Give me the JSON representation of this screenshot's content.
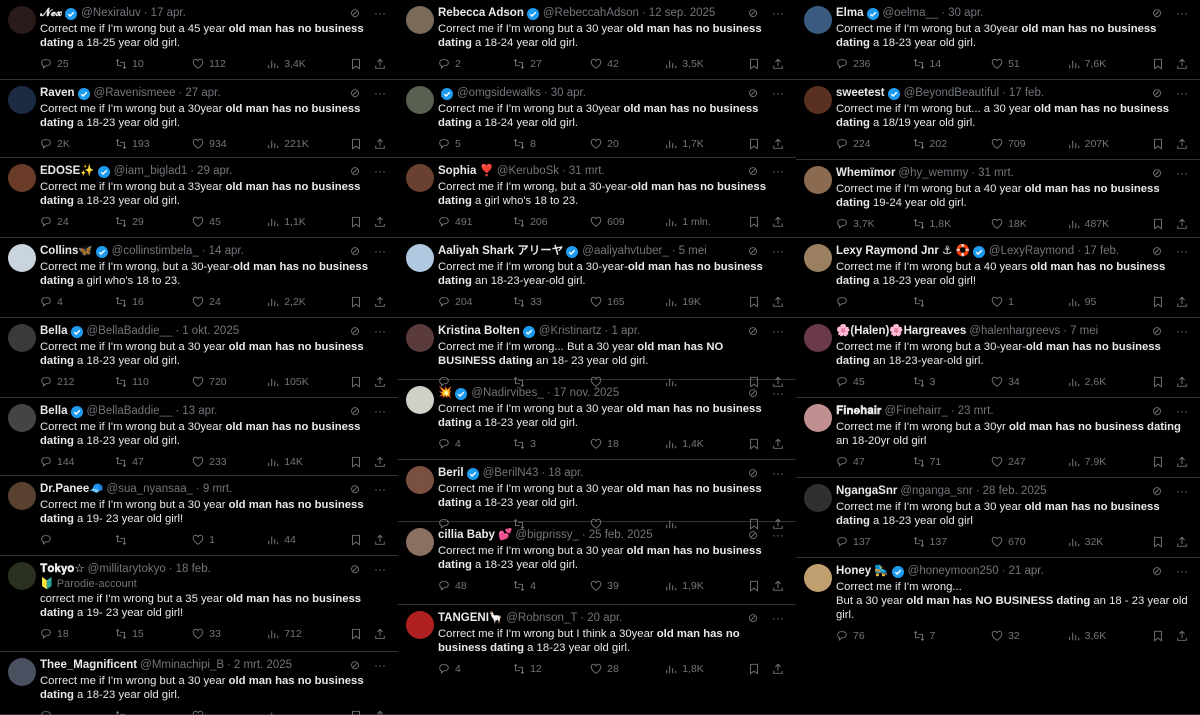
{
  "columns": [
    [
      {
        "name": "𝓝𝓮𝔁",
        "handle": "@Nexiraluv",
        "date": "17 apr.",
        "verified": true,
        "pre": "Correct me if I'm wrong but a 45 year ",
        "bold": "old man has no business dating",
        "post": " a 18-25 year old girl.",
        "replies": "25",
        "reposts": "10",
        "likes": "112",
        "views": "3,4K",
        "avatar": "#2b1a1a"
      },
      {
        "name": "Raven",
        "handle": "@Ravenismeee",
        "date": "27 apr.",
        "verified": true,
        "pre": "Correct me if I'm wrong but a 30year ",
        "bold": "old man has no business dating",
        "post": " a 18-23 year old girl.",
        "replies": "2K",
        "reposts": "193",
        "likes": "934",
        "views": "221K",
        "avatar": "#1d2a44"
      },
      {
        "name": "EDOSE✨",
        "handle": "@iam_biglad1",
        "date": "29 apr.",
        "verified": true,
        "pre": "Correct me if I'm wrong but a 33year ",
        "bold": "old man has no business dating",
        "post": " a 18-23 year old girl.",
        "replies": "24",
        "reposts": "29",
        "likes": "45",
        "views": "1,1K",
        "avatar": "#6b3b2a"
      },
      {
        "name": "Collins🦋",
        "handle": "@collinstimbela_",
        "date": "14 apr.",
        "verified": true,
        "pre": "Correct me if I'm wrong, but a 30-year-",
        "bold": "old man has no business dating",
        "post": " a girl who's 18 to 23.",
        "replies": "4",
        "reposts": "16",
        "likes": "24",
        "views": "2,2K",
        "avatar": "#c9d4de"
      },
      {
        "name": "Bella",
        "handle": "@BellaBaddie__",
        "date": "1 okt. 2025",
        "verified": true,
        "pre": "Correct me if I'm wrong but a 30 year ",
        "bold": "old man has no business dating",
        "post": " a 18-23 year old girl.",
        "replies": "212",
        "reposts": "110",
        "likes": "720",
        "views": "105K",
        "avatar": "#3a3a3a"
      },
      {
        "name": "Bella",
        "handle": "@BellaBaddie__",
        "date": "13 apr.",
        "verified": true,
        "pre": "Correct me if I'm wrong but a 30year ",
        "bold": "old man has no business dating",
        "post": " a 18-23 year old girl.",
        "replies": "144",
        "reposts": "47",
        "likes": "233",
        "views": "14K",
        "avatar": "#444"
      },
      {
        "name": "Dr.Panee🧢",
        "handle": "@sua_nyansaa_",
        "date": "9 mrt.",
        "verified": false,
        "pre": "Correct me if I'm wrong but a 30 year ",
        "bold": "old man has no business dating",
        "post": " a 19- 23 year old girl!",
        "replies": "",
        "reposts": "",
        "likes": "1",
        "views": "44",
        "avatar": "#5a4030"
      },
      {
        "name": "𝐓𝐨𝐤𝐲𝐨☆",
        "handle": "@millitarytokyo",
        "date": "18 feb.",
        "verified": false,
        "sub": "🔰 Parodie-account",
        "pre": "correct me if I'm wrong but a 35 year ",
        "bold": "old man has no business  dating",
        "post": " a 19- 23 year old girl!",
        "replies": "18",
        "reposts": "15",
        "likes": "33",
        "views": "712",
        "avatar": "#2a3020"
      },
      {
        "name": "Thee_Magnificent",
        "handle": "@Mminachipi_B",
        "date": "2 mrt. 2025",
        "verified": false,
        "pre": "Correct me if I'm wrong but a 30 year ",
        "bold": "old man has no business dating",
        "post": " a 18-23 year old girl.",
        "replies": "",
        "reposts": "",
        "likes": "",
        "views": "",
        "avatar": "#4a5060"
      }
    ],
    [
      {
        "name": "Rebecca Adson",
        "handle": "@RebeccahAdson",
        "date": "12 sep. 2025",
        "verified": true,
        "pre": "Correct me if I'm wrong but a 30 year ",
        "bold": "old man has no business dating",
        "post": " a 18-24 year old girl.",
        "replies": "2",
        "reposts": "27",
        "likes": "42",
        "views": "3,5K",
        "avatar": "#7a6a5a"
      },
      {
        "name": "",
        "handle": "@omgsidewalks",
        "date": "30 apr.",
        "verified": true,
        "pre": "Correct me if I'm wrong but a 30year ",
        "bold": "old man has no business dating",
        "post": " a 18-24 year old girl.",
        "replies": "5",
        "reposts": "8",
        "likes": "20",
        "views": "1,7K",
        "avatar": "#5a6050"
      },
      {
        "name": "Sophia ❣️",
        "handle": "@KeruboSk",
        "date": "31 mrt.",
        "verified": false,
        "pre": "Correct me if I'm wrong, but a 30-year-",
        "bold": "old man has no business dating",
        "post": " a girl who's 18 to 23.",
        "replies": "491",
        "reposts": "206",
        "likes": "609",
        "views": "1 mln.",
        "avatar": "#6a4030"
      },
      {
        "name": "Aaliyah Shark アリーヤ",
        "handle": "@aaliyahvtuber_",
        "date": "5 mei",
        "verified": true,
        "pre": "Correct me if I'm wrong but a 30-year-",
        "bold": "old man has no business dating",
        "post": " an 18-23-year-old girl.",
        "replies": "204",
        "reposts": "33",
        "likes": "165",
        "views": "19K",
        "avatar": "#b0c8e0"
      },
      {
        "name": "Kristina Bolten",
        "handle": "@Kristinartz",
        "date": "1 apr.",
        "verified": true,
        "pre": "Correct me if I'm wrong... But a 30 year ",
        "bold": "old man has NO BUSINESS dating",
        "post": " an 18- 23 year old girl.",
        "replies": "",
        "reposts": "",
        "likes": "",
        "views": "",
        "avatar": "#5a3a3a"
      },
      {
        "name": "💥",
        "handle": "@Nadirvibes_",
        "date": "17 nov. 2025",
        "verified": true,
        "pre": "Correct me if I'm wrong but a 30 year ",
        "bold": "old man has no business dating",
        "post": " a 18-23 year old girl.",
        "replies": "4",
        "reposts": "3",
        "likes": "18",
        "views": "1,4K",
        "avatar": "#d0d0c8"
      },
      {
        "name": "Beril",
        "handle": "@BerilN43",
        "date": "18 apr.",
        "verified": true,
        "pre": "Correct me if I'm wrong but a 30 year ",
        "bold": "old man has no business  dating",
        "post": " a 18-23 year old girl.",
        "replies": "",
        "reposts": "",
        "likes": "",
        "views": "",
        "avatar": "#7a5040"
      },
      {
        "name": "cillia Baby 💕",
        "handle": "@bigprissy_",
        "date": "25 feb. 2025",
        "verified": false,
        "pre": "Correct me if I'm wrong but a 30 year ",
        "bold": "old man has no business dating",
        "post": " a 18-23 year old girl.",
        "replies": "48",
        "reposts": "4",
        "likes": "39",
        "views": "1,9K",
        "avatar": "#8a7060"
      },
      {
        "name": "TANGENI🦙",
        "handle": "@Robnson_T",
        "date": "20 apr.",
        "verified": false,
        "pre": "Correct me if I'm wrong but I think a 30year ",
        "bold": "old man has no business dating",
        "post": " a 18-23 year old girl.",
        "replies": "4",
        "reposts": "12",
        "likes": "28",
        "views": "1,8K",
        "avatar": "#b02020"
      }
    ],
    [
      {
        "name": "Elma",
        "handle": "@oelma__",
        "date": "30 apr.",
        "verified": true,
        "pre": "Correct me if I'm wrong but a 30year ",
        "bold": "old man has no business dating",
        "post": " a 18-23 year old girl.",
        "replies": "236",
        "reposts": "14",
        "likes": "51",
        "views": "7,6K",
        "avatar": "#3a5a80"
      },
      {
        "name": "sweetest",
        "handle": "@BeyondBeautiful",
        "date": "17 feb.",
        "verified": true,
        "pre": "Correct me if I'm wrong but... a 30 year ",
        "bold": "old man has no business dating",
        "post": " a 18/19 year old girl.",
        "replies": "224",
        "reposts": "202",
        "likes": "709",
        "views": "207K",
        "avatar": "#5a3020"
      },
      {
        "name": "Whemïmor",
        "handle": "@hy_wemmy",
        "date": "31 mrt.",
        "verified": false,
        "pre": "Correct me if I'm wrong but a 40 year ",
        "bold": "old man has no business dating",
        "post": " 19-24 year old girl.",
        "replies": "3,7K",
        "reposts": "1,8K",
        "likes": "18K",
        "views": "487K",
        "avatar": "#8a6a50"
      },
      {
        "name": "Lexy Raymond Jnr ⚓ 🛟",
        "handle": "@LexyRaymond",
        "date": "17 feb.",
        "verified": true,
        "pre": "Correct me if I'm wrong but a 40 years ",
        "bold": "old man has no business  dating",
        "post": " a 18-23 year old girl!",
        "replies": "",
        "reposts": "",
        "likes": "1",
        "views": "95",
        "avatar": "#9a8060"
      },
      {
        "name": "🌸(Halen)🌸Hargreaves",
        "handle": "@halenhargreevs",
        "date": "7 mei",
        "verified": false,
        "pre": "Correct me if I'm wrong but a 30-year-",
        "bold": "old man has no business dating",
        "post": " an 18-23-year-old girl.",
        "replies": "45",
        "reposts": "3",
        "likes": "34",
        "views": "2,6K",
        "avatar": "#6a3a4a"
      },
      {
        "name": "𝐅𝐢𝐧𝐞𝐡𝐚𝐢𝐫",
        "handle": "@Finehairr_",
        "date": "23 mrt.",
        "verified": false,
        "pre": "Correct me if I'm wrong but a 30yr ",
        "bold": "old man has no business dating",
        "post": " an 18-20yr old girl",
        "replies": "47",
        "reposts": "71",
        "likes": "247",
        "views": "7,9K",
        "avatar": "#c09090"
      },
      {
        "name": "NgangaSnr",
        "handle": "@nganga_snr",
        "date": "28 feb. 2025",
        "verified": false,
        "pre": "Correct me if I'm wrong but a 30 year ",
        "bold": "old man has no business dating",
        "post": " a 18-23 year old girl",
        "replies": "137",
        "reposts": "137",
        "likes": "670",
        "views": "32K",
        "avatar": "#303030"
      },
      {
        "name": "Honey 🛼",
        "handle": "@honeymoon250",
        "date": "21 apr.",
        "verified": true,
        "pre": "Correct me if I'm wrong...\nBut a 30 year ",
        "bold": "old man has NO BUSINESS dating",
        "post": " an 18 - 23 year old girl.",
        "replies": "76",
        "reposts": "7",
        "likes": "32",
        "views": "3,6K",
        "avatar": "#c0a070"
      }
    ]
  ],
  "colors": {
    "bg": "#000000",
    "text": "#e7e9ea",
    "muted": "#71767b",
    "verified": "#1d9bf0",
    "border": "#2f3336"
  }
}
